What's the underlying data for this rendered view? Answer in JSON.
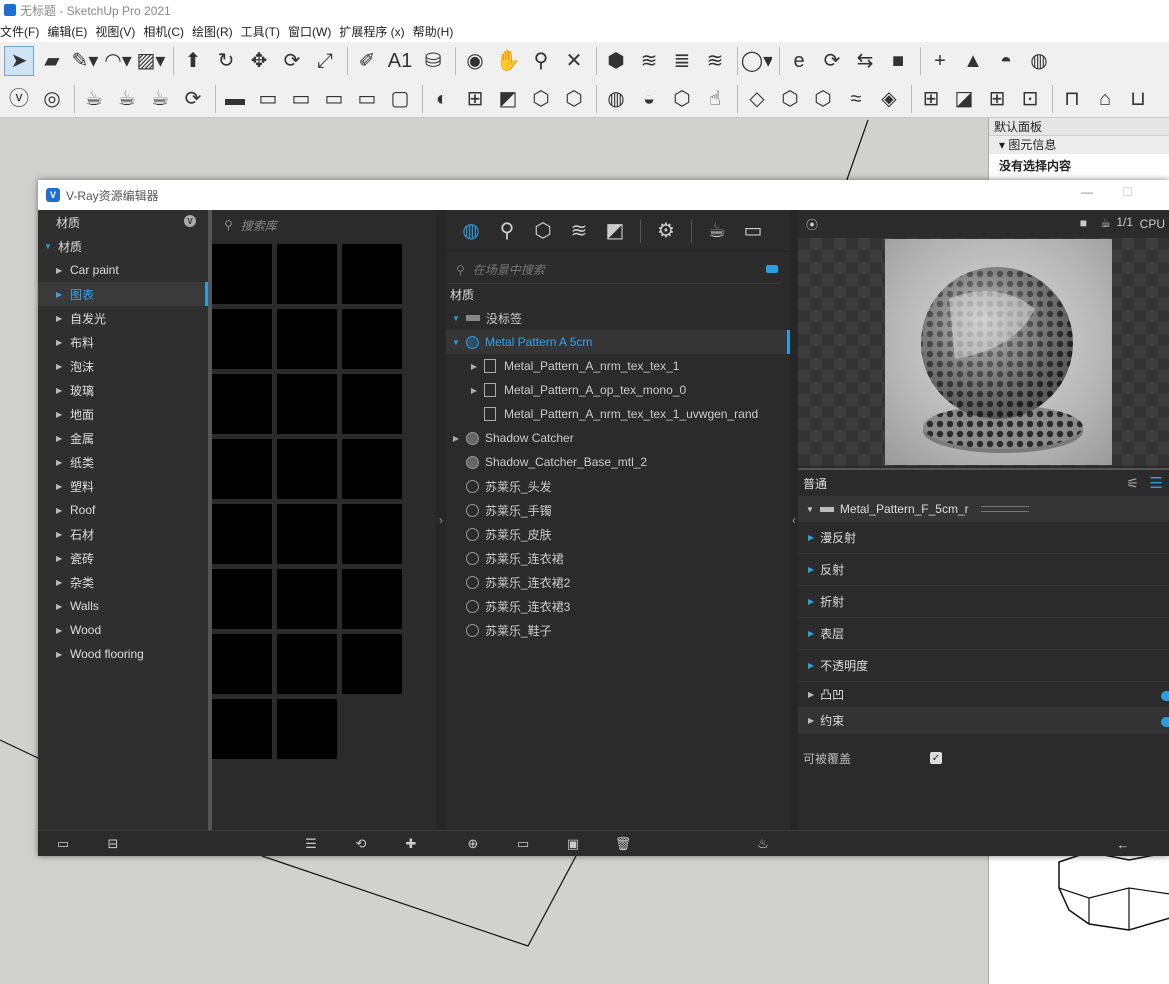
{
  "app": {
    "title": "无标题 - SketchUp Pro 2021",
    "menu": [
      "文件(F)",
      "编辑(E)",
      "视图(V)",
      "相机(C)",
      "绘图(R)",
      "工具(T)",
      "窗口(W)",
      "扩展程序 (x)",
      "帮助(H)"
    ]
  },
  "toolbar1": [
    {
      "name": "select-tool",
      "glyph": "➤"
    },
    {
      "name": "eraser-tool",
      "glyph": "▰"
    },
    {
      "name": "line-tool",
      "glyph": "✎▾"
    },
    {
      "name": "arc-tool",
      "glyph": "◠▾"
    },
    {
      "name": "rectangle-tool",
      "glyph": "▨▾"
    },
    {
      "name": "push-pull-tool",
      "glyph": "⬆"
    },
    {
      "name": "offset-tool",
      "glyph": "↻"
    },
    {
      "name": "move-tool",
      "glyph": "✥"
    },
    {
      "name": "rotate-tool",
      "glyph": "⟳"
    },
    {
      "name": "scale-tool",
      "glyph": "⤢"
    },
    {
      "name": "tape-measure-tool",
      "glyph": "✐"
    },
    {
      "name": "text-tool",
      "glyph": "A1"
    },
    {
      "name": "paint-bucket-tool",
      "glyph": "⛁"
    },
    {
      "name": "orbit-tool",
      "glyph": "◉"
    },
    {
      "name": "pan-tool",
      "glyph": "✋"
    },
    {
      "name": "zoom-tool",
      "glyph": "⚲"
    },
    {
      "name": "zoom-extents-tool",
      "glyph": "✕"
    },
    {
      "name": "warehouse-icon",
      "glyph": "⬢"
    },
    {
      "name": "extension-warehouse-icon",
      "glyph": "≋"
    },
    {
      "name": "layers-icon",
      "glyph": "≣"
    },
    {
      "name": "extension-manager-icon",
      "glyph": "≋"
    },
    {
      "name": "user-account-icon",
      "glyph": "◯▾"
    },
    {
      "name": "enscape-start-icon",
      "glyph": "e"
    },
    {
      "name": "enscape-sync-icon",
      "glyph": "⟳"
    },
    {
      "name": "enscape-link-icon",
      "glyph": "⇆"
    },
    {
      "name": "enscape-video-icon",
      "glyph": "■"
    },
    {
      "name": "add-icon",
      "glyph": "+"
    },
    {
      "name": "tree-icon",
      "glyph": "▲"
    },
    {
      "name": "sun-icon",
      "glyph": "◓"
    },
    {
      "name": "checker-sphere-icon",
      "glyph": "◍"
    }
  ],
  "toolbar2": [
    {
      "name": "vray-logo-icon",
      "glyph": "ⓥ"
    },
    {
      "name": "vray-asset-editor-icon",
      "glyph": "◎"
    },
    {
      "name": "vray-render-icon",
      "glyph": "☕"
    },
    {
      "name": "vray-interactive-render-icon",
      "glyph": "☕"
    },
    {
      "name": "vray-vision-icon",
      "glyph": "☕"
    },
    {
      "name": "vray-cloud-icon",
      "glyph": "⟳"
    },
    {
      "name": "vray-batch-icon",
      "glyph": "▬"
    },
    {
      "name": "vray-frame-buffer-icon",
      "glyph": "▭"
    },
    {
      "name": "vray-window-icon",
      "glyph": "▭"
    },
    {
      "name": "vray-viewport-icon",
      "glyph": "▭"
    },
    {
      "name": "vray-region-icon",
      "glyph": "▭"
    },
    {
      "name": "vray-lock-icon",
      "glyph": "▢"
    },
    {
      "name": "vray-light-gen-icon",
      "glyph": "◐"
    },
    {
      "name": "vray-material-override-icon",
      "glyph": "⊞"
    },
    {
      "name": "vray-section-icon",
      "glyph": "◩"
    },
    {
      "name": "vray-proxy-icon",
      "glyph": "⬡"
    },
    {
      "name": "vray-mesh-icon",
      "glyph": "⬡"
    },
    {
      "name": "vray-sphere-icon",
      "glyph": "◍"
    },
    {
      "name": "vray-dome-icon",
      "glyph": "◒"
    },
    {
      "name": "vray-export-icon",
      "glyph": "⬡"
    },
    {
      "name": "vray-cursor-icon",
      "glyph": "☝"
    },
    {
      "name": "vray-rect-light-icon",
      "glyph": "◇"
    },
    {
      "name": "vray-box-icon",
      "glyph": "⬡"
    },
    {
      "name": "vray-box-plus-icon",
      "glyph": "⬡"
    },
    {
      "name": "vray-fur-icon",
      "glyph": "≈"
    },
    {
      "name": "vray-scatter-icon",
      "glyph": "◈"
    },
    {
      "name": "vray-grid-icon",
      "glyph": "⊞"
    },
    {
      "name": "vray-clipper-icon",
      "glyph": "◪"
    },
    {
      "name": "vray-grid2-icon",
      "glyph": "⊞"
    },
    {
      "name": "vray-frame-icon",
      "glyph": "⊡"
    },
    {
      "name": "vray-camera-icon",
      "glyph": "⊓"
    },
    {
      "name": "vray-house-icon",
      "glyph": "⌂"
    },
    {
      "name": "vray-tray-icon",
      "glyph": "⊔"
    }
  ],
  "tray": {
    "title": "默认面板",
    "section": "图元信息",
    "empty": "没有选择内容"
  },
  "vray": {
    "title": "V-Ray资源编辑器",
    "library": {
      "header": "材质",
      "root": "材质",
      "categories": [
        "Car paint",
        "图表",
        "自发光",
        "布料",
        "泡沫",
        "玻璃",
        "地面",
        "金属",
        "纸类",
        "塑料",
        "Roof",
        "石材",
        "瓷砖",
        "杂类",
        "Walls",
        "Wood",
        "Wood flooring"
      ],
      "selected_index": 1,
      "search_placeholder": "搜索库",
      "thumb_count": 23
    },
    "scene": {
      "search_placeholder": "在场景中搜索",
      "header": "材质",
      "group": "没标签",
      "selected": "Metal Pattern A 5cm",
      "children": [
        "Metal_Pattern_A_nrm_tex_tex_1",
        "Metal_Pattern_A_op_tex_mono_0",
        "Metal_Pattern_A_nrm_tex_tex_1_uvwgen_rand"
      ],
      "others": [
        {
          "label": "Shadow Catcher",
          "type": "toggle"
        },
        {
          "label": "Shadow_Catcher_Base_mtl_2",
          "type": "filled"
        },
        {
          "label": "苏莱乐_头发",
          "type": "empty"
        },
        {
          "label": "苏莱乐_手镯",
          "type": "empty"
        },
        {
          "label": "苏莱乐_皮肤",
          "type": "empty"
        },
        {
          "label": "苏莱乐_连衣裙",
          "type": "empty"
        },
        {
          "label": "苏莱乐_连衣裙2",
          "type": "empty"
        },
        {
          "label": "苏莱乐_连衣裙3",
          "type": "empty"
        },
        {
          "label": "苏莱乐_鞋子",
          "type": "empty"
        }
      ]
    },
    "props": {
      "preview_ratio": "1/1",
      "preview_mode": "CPU",
      "header": "普通",
      "material": "Metal_Pattern_F_5cm_r",
      "sections": [
        "漫反射",
        "反射",
        "折射",
        "表层",
        "不透明度"
      ],
      "toggles": [
        "凸凹",
        "约束"
      ],
      "override_label": "可被覆盖",
      "override_checked": true
    }
  },
  "colors": {
    "accent": "#2b9ee0",
    "panel": "#2b2b2b",
    "viewport": "#d1d1cf"
  }
}
